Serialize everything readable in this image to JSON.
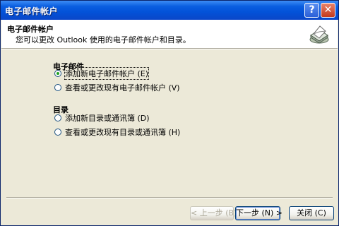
{
  "window": {
    "title": "电子邮件帐户",
    "help_glyph": "?",
    "close_glyph": "✕"
  },
  "header": {
    "title": "电子邮件帐户",
    "subtitle": "您可以更改 Outlook 使用的电子邮件帐户和目录。",
    "icon": "mailbox-icon"
  },
  "email_group": {
    "label": "电子邮件",
    "options": [
      {
        "label": "添加新电子邮件帐户 (E)",
        "selected": true
      },
      {
        "label": "查看或更改现有电子邮件帐户 (V)",
        "selected": false
      }
    ]
  },
  "directory_group": {
    "label": "目录",
    "options": [
      {
        "label": "添加新目录或通讯簿 (D)",
        "selected": false
      },
      {
        "label": "查看或更改现有目录或通讯簿 (H)",
        "selected": false
      }
    ]
  },
  "footer": {
    "back_label": "< 上一步 (B)",
    "next_label": "下一步 (N) >",
    "close_label": "关闭 (C)"
  }
}
